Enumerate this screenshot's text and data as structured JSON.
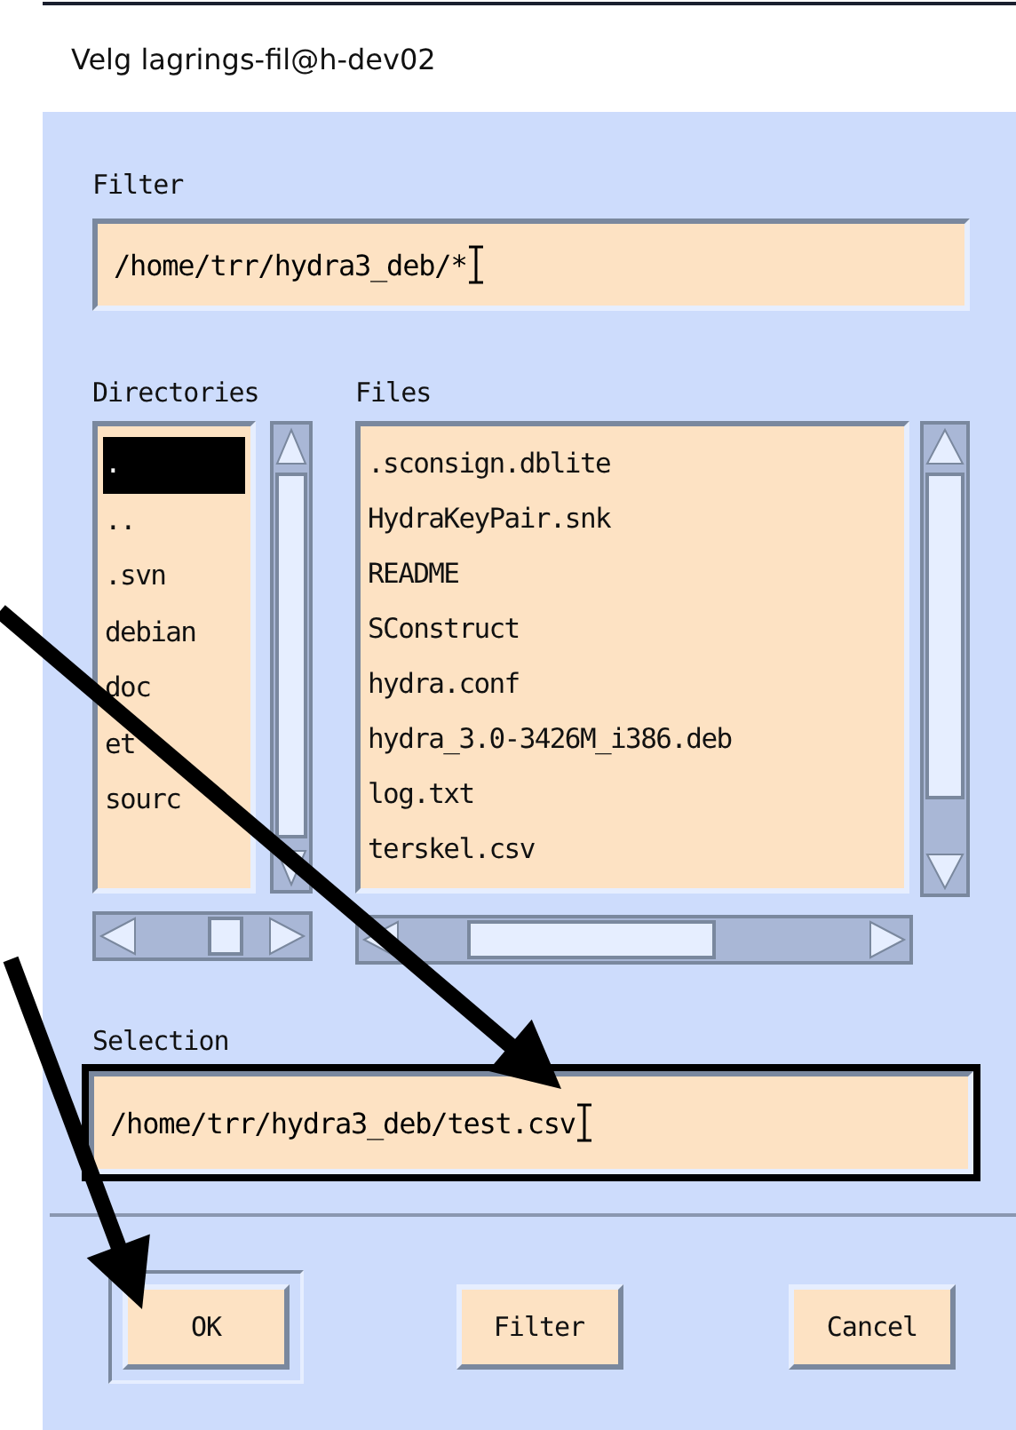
{
  "window": {
    "title": "Velg lagrings-fil@h-dev02"
  },
  "filter": {
    "label": "Filter",
    "value": "/home/trr/hydra3_deb/*",
    "focused": false
  },
  "directories": {
    "label": "Directories",
    "items": [
      {
        "name": ".",
        "selected": true
      },
      {
        "name": "..",
        "selected": false
      },
      {
        "name": ".svn",
        "selected": false
      },
      {
        "name": "debian",
        "selected": false
      },
      {
        "name": "doc",
        "selected": false
      },
      {
        "name": "et",
        "selected": false
      },
      {
        "name": "sourc",
        "selected": false
      }
    ]
  },
  "files": {
    "label": "Files",
    "items": [
      {
        "name": ".sconsign.dblite",
        "selected": false
      },
      {
        "name": "HydraKeyPair.snk",
        "selected": false
      },
      {
        "name": "README",
        "selected": false
      },
      {
        "name": "SConstruct",
        "selected": false
      },
      {
        "name": "hydra.conf",
        "selected": false
      },
      {
        "name": "hydra_3.0-3426M_i386.deb",
        "selected": false
      },
      {
        "name": "log.txt",
        "selected": false
      },
      {
        "name": "terskel.csv",
        "selected": false
      }
    ]
  },
  "selection": {
    "label": "Selection",
    "value": "/home/trr/hydra3_deb/test.csv",
    "focused": true
  },
  "buttons": [
    {
      "label": "OK",
      "default": true
    },
    {
      "label": "Filter",
      "default": false
    },
    {
      "label": "Cancel",
      "default": false
    }
  ]
}
